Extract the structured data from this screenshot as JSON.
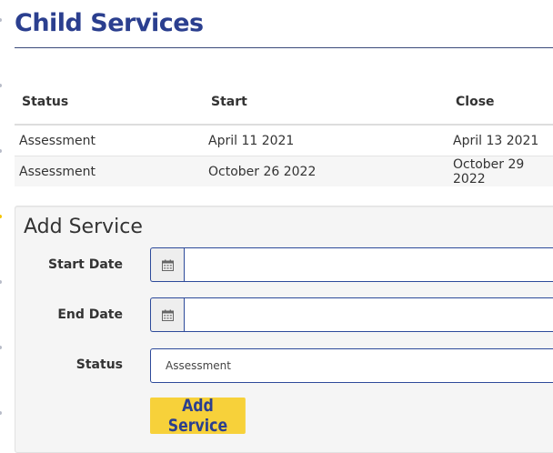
{
  "page": {
    "title": "Child Services"
  },
  "table": {
    "headers": {
      "status": "Status",
      "start": "Start",
      "close": "Close"
    },
    "rows": [
      {
        "status": "Assessment",
        "start": "April 11 2021",
        "close": "April 13 2021"
      },
      {
        "status": "Assessment",
        "start": "October 26 2022",
        "close": "October 29 2022"
      }
    ]
  },
  "form": {
    "title": "Add Service",
    "start_date_label": "Start Date",
    "start_date_value": "",
    "end_date_label": "End Date",
    "end_date_value": "",
    "status_label": "Status",
    "status_selected": "Assessment",
    "calendar_icon": "calendar-icon",
    "submit_label": "Add Service"
  },
  "colors": {
    "title": "#2b3f8f",
    "button_bg": "#f7d13a",
    "input_border": "#2d4a9a"
  }
}
